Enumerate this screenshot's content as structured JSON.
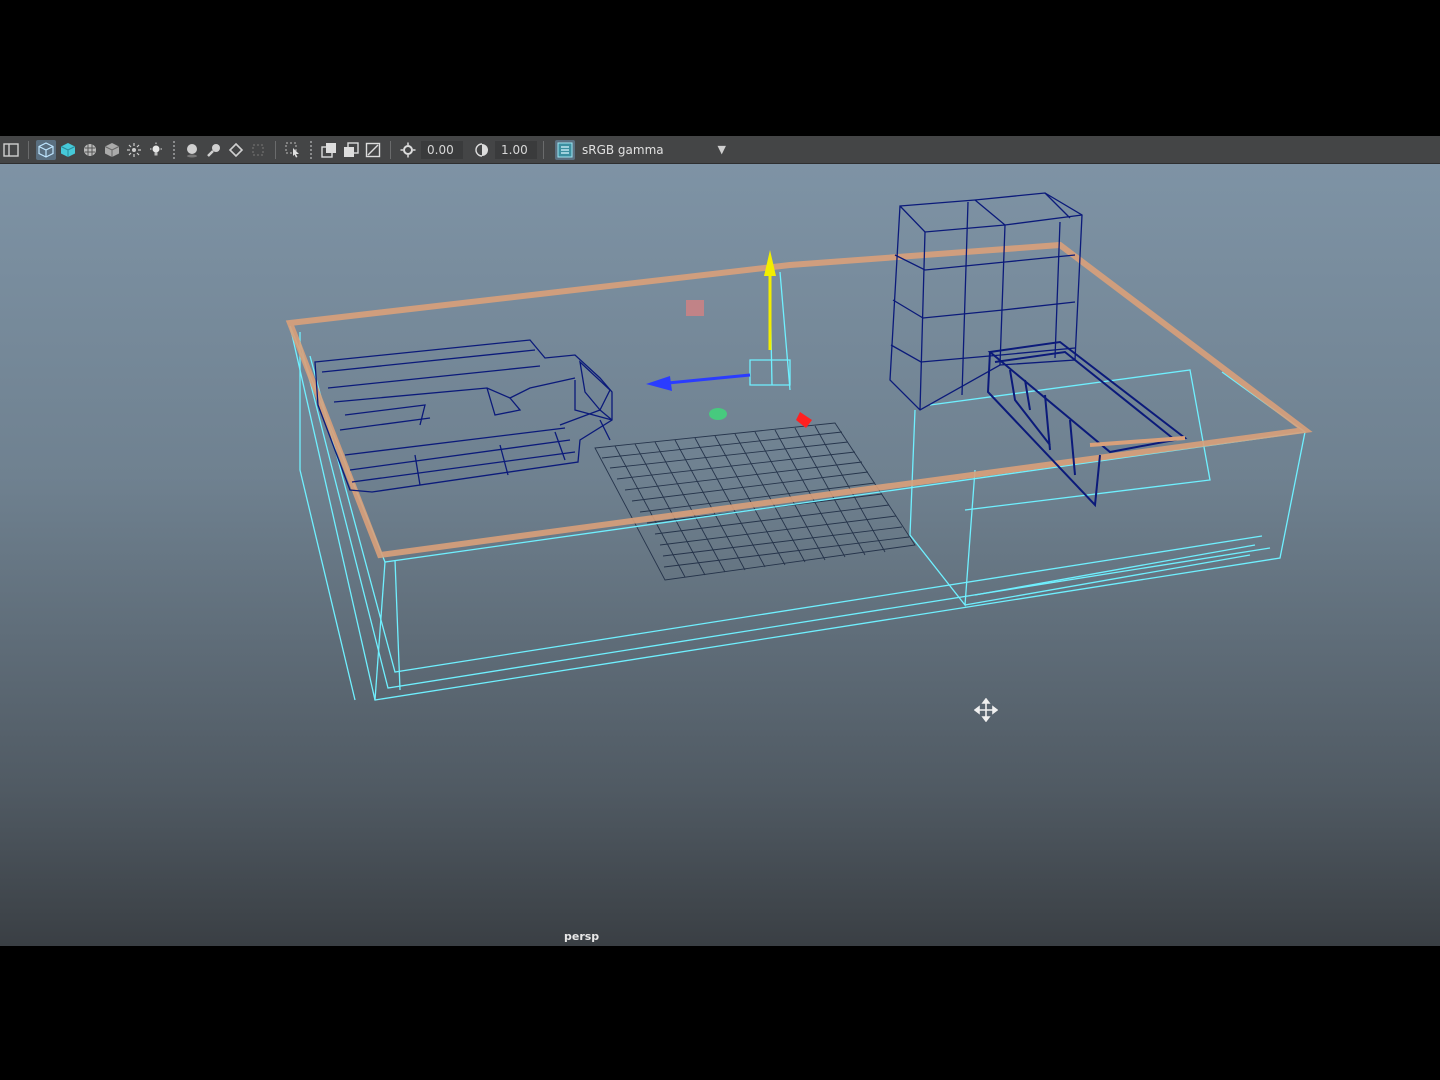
{
  "toolbar": {
    "icons": [
      "panel-layout-icon",
      "wireframe-icon",
      "smooth-shade-icon",
      "textured-icon",
      "lights-icon",
      "xray-icon",
      "use-lights-icon",
      "shadows-icon",
      "ambient-occlusion-icon",
      "motion-blur-icon",
      "antialias-icon",
      "isolate-select-icon",
      "xray-joints-icon",
      "xray-active-icon",
      "backface-icon",
      "exposure-icon",
      "gamma-icon",
      "color-management-icon"
    ],
    "exposure_value": "0.00",
    "gamma_value": "1.00",
    "color_space": "sRGB gamma"
  },
  "viewport": {
    "camera": "persp",
    "colors": {
      "wire_default": "#0b1a7a",
      "wire_selected": "#6ff0ff",
      "highlight_orange": "#d9a07a",
      "axis_y": "#f2ee00",
      "axis_z": "#2a3cff",
      "axis_x": "#ff2020",
      "center_green": "#3fd67a",
      "center_red": "#d98080"
    }
  }
}
